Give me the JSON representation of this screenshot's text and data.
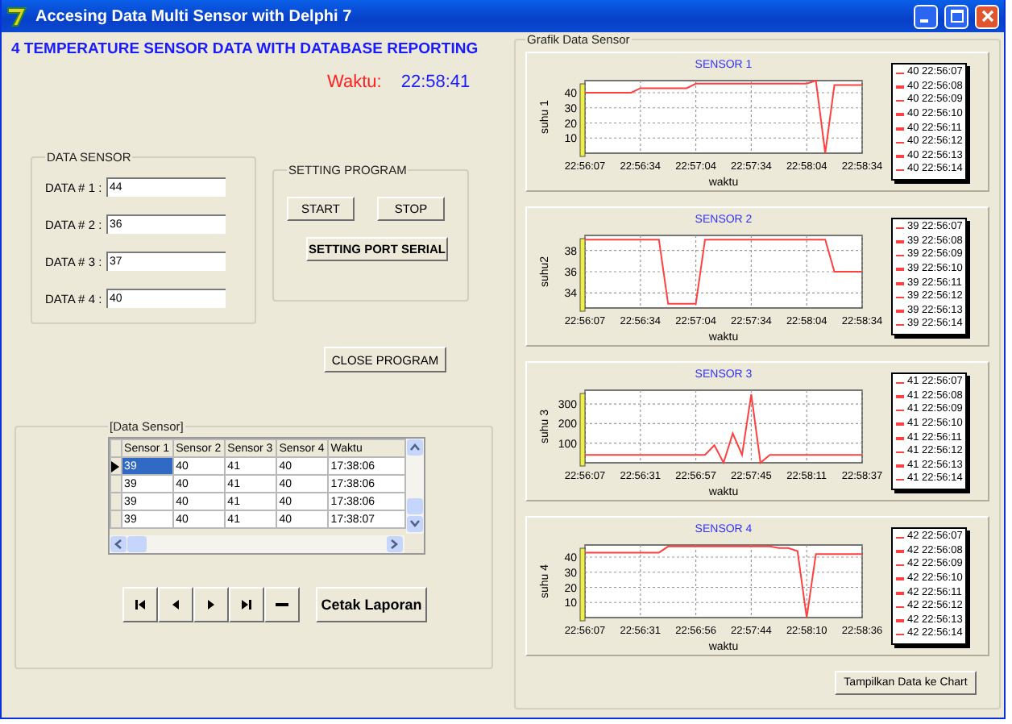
{
  "window": {
    "title": "Accesing Data Multi Sensor with Delphi 7"
  },
  "header": {
    "title": "4 TEMPERATURE SENSOR DATA WITH DATABASE REPORTING",
    "time_label": "Waktu:",
    "time": "22:58:41"
  },
  "data_sensor": {
    "title": "DATA SENSOR",
    "fields": [
      {
        "label": "DATA # 1 :",
        "value": "44"
      },
      {
        "label": "DATA # 2 :",
        "value": "36"
      },
      {
        "label": "DATA # 3 :",
        "value": "37"
      },
      {
        "label": "DATA # 4 :",
        "value": "40"
      }
    ]
  },
  "setting_program": {
    "title": "SETTING PROGRAM",
    "start": "START",
    "stop": "STOP",
    "port": "SETTING PORT SERIAL"
  },
  "close_button": "CLOSE PROGRAM",
  "grid_panel": {
    "title": "[Data Sensor]",
    "columns": [
      "Sensor 1",
      "Sensor 2",
      "Sensor 3",
      "Sensor 4",
      "Waktu"
    ],
    "rows": [
      {
        "cells": [
          "39",
          "40",
          "41",
          "40",
          "17:38:06"
        ],
        "selected": true
      },
      {
        "cells": [
          "39",
          "40",
          "41",
          "40",
          "17:38:06"
        ],
        "selected": false
      },
      {
        "cells": [
          "39",
          "40",
          "41",
          "40",
          "17:38:06"
        ],
        "selected": false
      },
      {
        "cells": [
          "39",
          "40",
          "41",
          "40",
          "17:38:07"
        ],
        "selected": false
      }
    ]
  },
  "navigator": [
    {
      "kind": "first"
    },
    {
      "kind": "prior"
    },
    {
      "kind": "next"
    },
    {
      "kind": "last"
    },
    {
      "kind": "delete"
    }
  ],
  "report_button": "Cetak Laporan",
  "chart_group": {
    "title": "Grafik Data Sensor",
    "show_button": "Tampilkan Data ke Chart",
    "charts": [
      {
        "legend": [
          "40 22:56:07",
          "40 22:56:08",
          "40 22:56:09",
          "40 22:56:10",
          "40 22:56:11",
          "40 22:56:12",
          "40 22:56:13",
          "40 22:56:14"
        ],
        "chart_data": {
          "type": "line",
          "title": "SENSOR 1",
          "xlabel": "waktu",
          "ylabel": "suhu 1",
          "categories": [
            "22:56:07",
            null,
            null,
            null,
            null,
            null,
            "22:56:34",
            null,
            null,
            null,
            null,
            null,
            "22:57:04",
            null,
            null,
            null,
            null,
            null,
            "22:57:34",
            null,
            null,
            null,
            null,
            null,
            "22:58:04",
            null,
            null,
            null,
            null,
            null,
            "22:58:34"
          ],
          "series": [
            {
              "color": "#ff4040",
              "values": [
                40,
                40,
                40,
                40,
                40,
                40,
                43,
                43,
                43,
                43,
                43,
                43,
                46,
                46,
                46,
                46,
                46,
                46,
                46,
                46,
                46,
                46,
                46,
                46,
                46,
                48,
                0,
                45,
                45,
                45,
                45
              ]
            }
          ],
          "ylim": [
            0,
            48
          ],
          "yticks": [
            10,
            20,
            30,
            40
          ],
          "grid": true
        }
      },
      {
        "legend": [
          "39 22:56:07",
          "39 22:56:08",
          "39 22:56:09",
          "39 22:56:10",
          "39 22:56:11",
          "39 22:56:12",
          "39 22:56:13",
          "39 22:56:14"
        ],
        "chart_data": {
          "type": "line",
          "title": "SENSOR 2",
          "xlabel": "waktu",
          "ylabel": "suhu2",
          "categories": [
            "22:56:07",
            null,
            null,
            null,
            null,
            null,
            "22:56:34",
            null,
            null,
            null,
            null,
            null,
            "22:57:04",
            null,
            null,
            null,
            null,
            null,
            "22:57:34",
            null,
            null,
            null,
            null,
            null,
            "22:58:04",
            null,
            null,
            null,
            null,
            null,
            "22:58:34"
          ],
          "series": [
            {
              "color": "#ff4040",
              "values": [
                39,
                39,
                39,
                39,
                39,
                39,
                39,
                39,
                39,
                33,
                33,
                33,
                33,
                39,
                39,
                39,
                39,
                39,
                39,
                39,
                39,
                39,
                39,
                39,
                39,
                39,
                39,
                36,
                36,
                36,
                36
              ]
            }
          ],
          "ylim": [
            32.6,
            39.4
          ],
          "yticks": [
            34,
            36,
            38
          ],
          "grid": true
        }
      },
      {
        "legend": [
          "41 22:56:07",
          "41 22:56:08",
          "41 22:56:09",
          "41 22:56:10",
          "41 22:56:11",
          "41 22:56:12",
          "41 22:56:13",
          "41 22:56:14"
        ],
        "chart_data": {
          "type": "line",
          "title": "SENSOR 3",
          "xlabel": "waktu",
          "ylabel": "suhu 3",
          "categories": [
            "22:56:07",
            null,
            null,
            null,
            null,
            null,
            "22:56:31",
            null,
            null,
            null,
            null,
            null,
            "22:56:57",
            null,
            null,
            null,
            null,
            null,
            "22:57:45",
            null,
            null,
            null,
            null,
            null,
            "22:58:11",
            null,
            null,
            null,
            null,
            null,
            "22:58:37"
          ],
          "series": [
            {
              "color": "#ff4040",
              "values": [
                40,
                40,
                40,
                40,
                40,
                40,
                40,
                40,
                40,
                40,
                40,
                40,
                40,
                40,
                90,
                0,
                150,
                40,
                350,
                0,
                40,
                40,
                40,
                40,
                40,
                40,
                40,
                40,
                40,
                40,
                40
              ]
            }
          ],
          "ylim": [
            0,
            370
          ],
          "yticks": [
            100,
            200,
            300
          ],
          "grid": true
        }
      },
      {
        "legend": [
          "42 22:56:07",
          "42 22:56:08",
          "42 22:56:09",
          "42 22:56:10",
          "42 22:56:11",
          "42 22:56:12",
          "42 22:56:13",
          "42 22:56:14"
        ],
        "chart_data": {
          "type": "line",
          "title": "SENSOR 4",
          "xlabel": "waktu",
          "ylabel": "suhu 4",
          "categories": [
            "22:56:07",
            null,
            null,
            null,
            null,
            null,
            "22:56:31",
            null,
            null,
            null,
            null,
            null,
            "22:56:56",
            null,
            null,
            null,
            null,
            null,
            "22:57:44",
            null,
            null,
            null,
            null,
            null,
            "22:58:10",
            null,
            null,
            null,
            null,
            null,
            "22:58:36"
          ],
          "series": [
            {
              "color": "#ff4040",
              "values": [
                43,
                43,
                43,
                43,
                43,
                43,
                43,
                43,
                43,
                47,
                47,
                47,
                47,
                47,
                47,
                47,
                47,
                47,
                47,
                47,
                47,
                46,
                46,
                44,
                0,
                42,
                42,
                42,
                42,
                42,
                42
              ]
            }
          ],
          "ylim": [
            0,
            48
          ],
          "yticks": [
            10,
            20,
            30,
            40
          ],
          "grid": true
        }
      }
    ]
  }
}
